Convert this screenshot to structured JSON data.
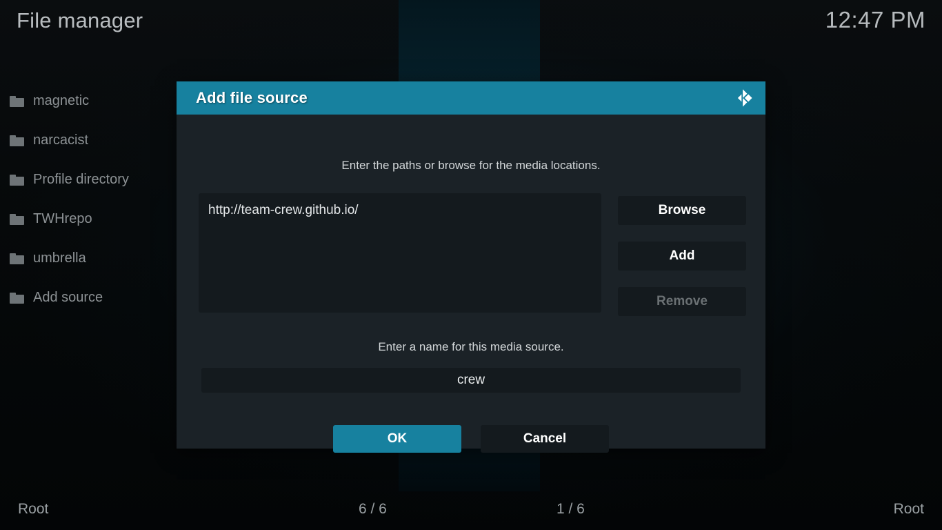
{
  "header": {
    "title": "File manager",
    "clock": "12:47 PM"
  },
  "colors": {
    "accent": "#17819f",
    "dialog_bg": "#1b2227",
    "field_bg": "#141a1e",
    "text": "#d8dcde",
    "text_dim": "#8d9295"
  },
  "sidebar": {
    "items": [
      {
        "label": "magnetic",
        "icon": "folder-icon"
      },
      {
        "label": "narcacist",
        "icon": "folder-icon"
      },
      {
        "label": "Profile directory",
        "icon": "folder-icon"
      },
      {
        "label": "TWHrepo",
        "icon": "folder-icon"
      },
      {
        "label": "umbrella",
        "icon": "folder-icon"
      },
      {
        "label": "Add source",
        "icon": "folder-icon"
      }
    ]
  },
  "dialog": {
    "title": "Add file source",
    "logo_icon": "kodi-logo-icon",
    "paths_hint": "Enter the paths or browse for the media locations.",
    "paths": [
      "http://team-crew.github.io/"
    ],
    "side_buttons": [
      {
        "label": "Browse",
        "enabled": true
      },
      {
        "label": "Add",
        "enabled": true
      },
      {
        "label": "Remove",
        "enabled": false
      }
    ],
    "name_hint": "Enter a name for this media source.",
    "name_value": "crew",
    "name_placeholder": "",
    "ok_label": "OK",
    "cancel_label": "Cancel"
  },
  "footer": {
    "left": "Root",
    "mid_left": "6 / 6",
    "mid_right": "1 / 6",
    "right": "Root"
  }
}
